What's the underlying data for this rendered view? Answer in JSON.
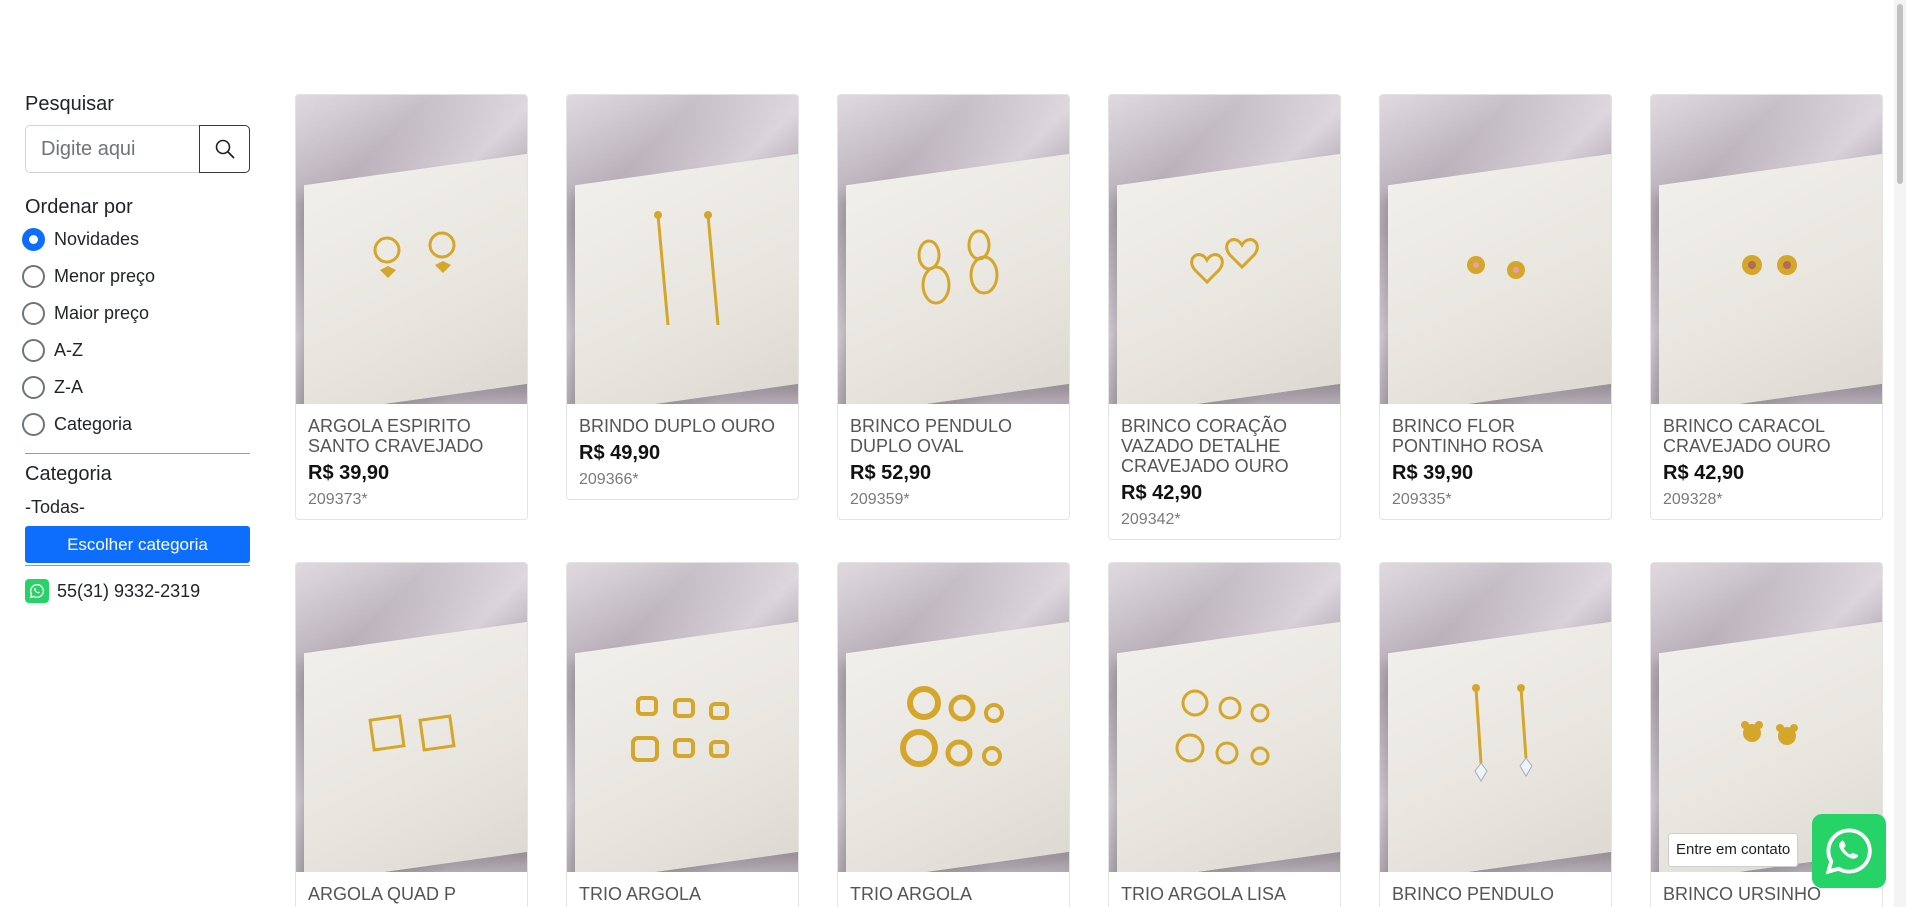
{
  "sidebar": {
    "search_label": "Pesquisar",
    "search_placeholder": "Digite aqui",
    "order_label": "Ordenar por",
    "order_options": [
      {
        "label": "Novidades",
        "checked": true
      },
      {
        "label": "Menor preço",
        "checked": false
      },
      {
        "label": "Maior preço",
        "checked": false
      },
      {
        "label": "A-Z",
        "checked": false
      },
      {
        "label": "Z-A",
        "checked": false
      },
      {
        "label": "Categoria",
        "checked": false
      }
    ],
    "category_label": "Categoria",
    "category_value": "-Todas-",
    "choose_category_button": "Escolher categoria",
    "phone": "55(31) 9332-2319"
  },
  "products": [
    {
      "name": "ARGOLA ESPIRITO SANTO CRAVEJADO",
      "price": "R$ 39,90",
      "code": "209373*",
      "jewel": "hoop-dove"
    },
    {
      "name": "BRINDO DUPLO OURO",
      "price": "R$ 49,90",
      "code": "209366*",
      "jewel": "long-drop"
    },
    {
      "name": "BRINCO PENDULO DUPLO OVAL",
      "price": "R$ 52,90",
      "code": "209359*",
      "jewel": "oval-drop"
    },
    {
      "name": "BRINCO CORAÇÃO VAZADO DETALHE CRAVEJADO OURO",
      "price": "R$ 42,90",
      "code": "209342*",
      "jewel": "hearts"
    },
    {
      "name": "BRINCO FLOR PONTINHO ROSA",
      "price": "R$ 39,90",
      "code": "209335*",
      "jewel": "flowers"
    },
    {
      "name": "BRINCO CARACOL CRAVEJADO OURO",
      "price": "R$ 42,90",
      "code": "209328*",
      "jewel": "snails"
    },
    {
      "name": "ARGOLA QUAD P",
      "price": "",
      "code": "",
      "jewel": "square-hoops"
    },
    {
      "name": "TRIO ARGOLA",
      "price": "",
      "code": "",
      "jewel": "trio-square"
    },
    {
      "name": "TRIO ARGOLA",
      "price": "",
      "code": "",
      "jewel": "trio-round-thick"
    },
    {
      "name": "TRIO ARGOLA LISA",
      "price": "",
      "code": "",
      "jewel": "trio-round"
    },
    {
      "name": "BRINCO PENDULO",
      "price": "",
      "code": "",
      "jewel": "crystal-drop"
    },
    {
      "name": "BRINCO URSINHO",
      "price": "",
      "code": "",
      "jewel": "bears"
    }
  ],
  "floating": {
    "contact_label": "Entre em contato"
  },
  "colors": {
    "primary": "#0d6efd",
    "whatsapp": "#25d366",
    "gold": "#d4a62a"
  }
}
